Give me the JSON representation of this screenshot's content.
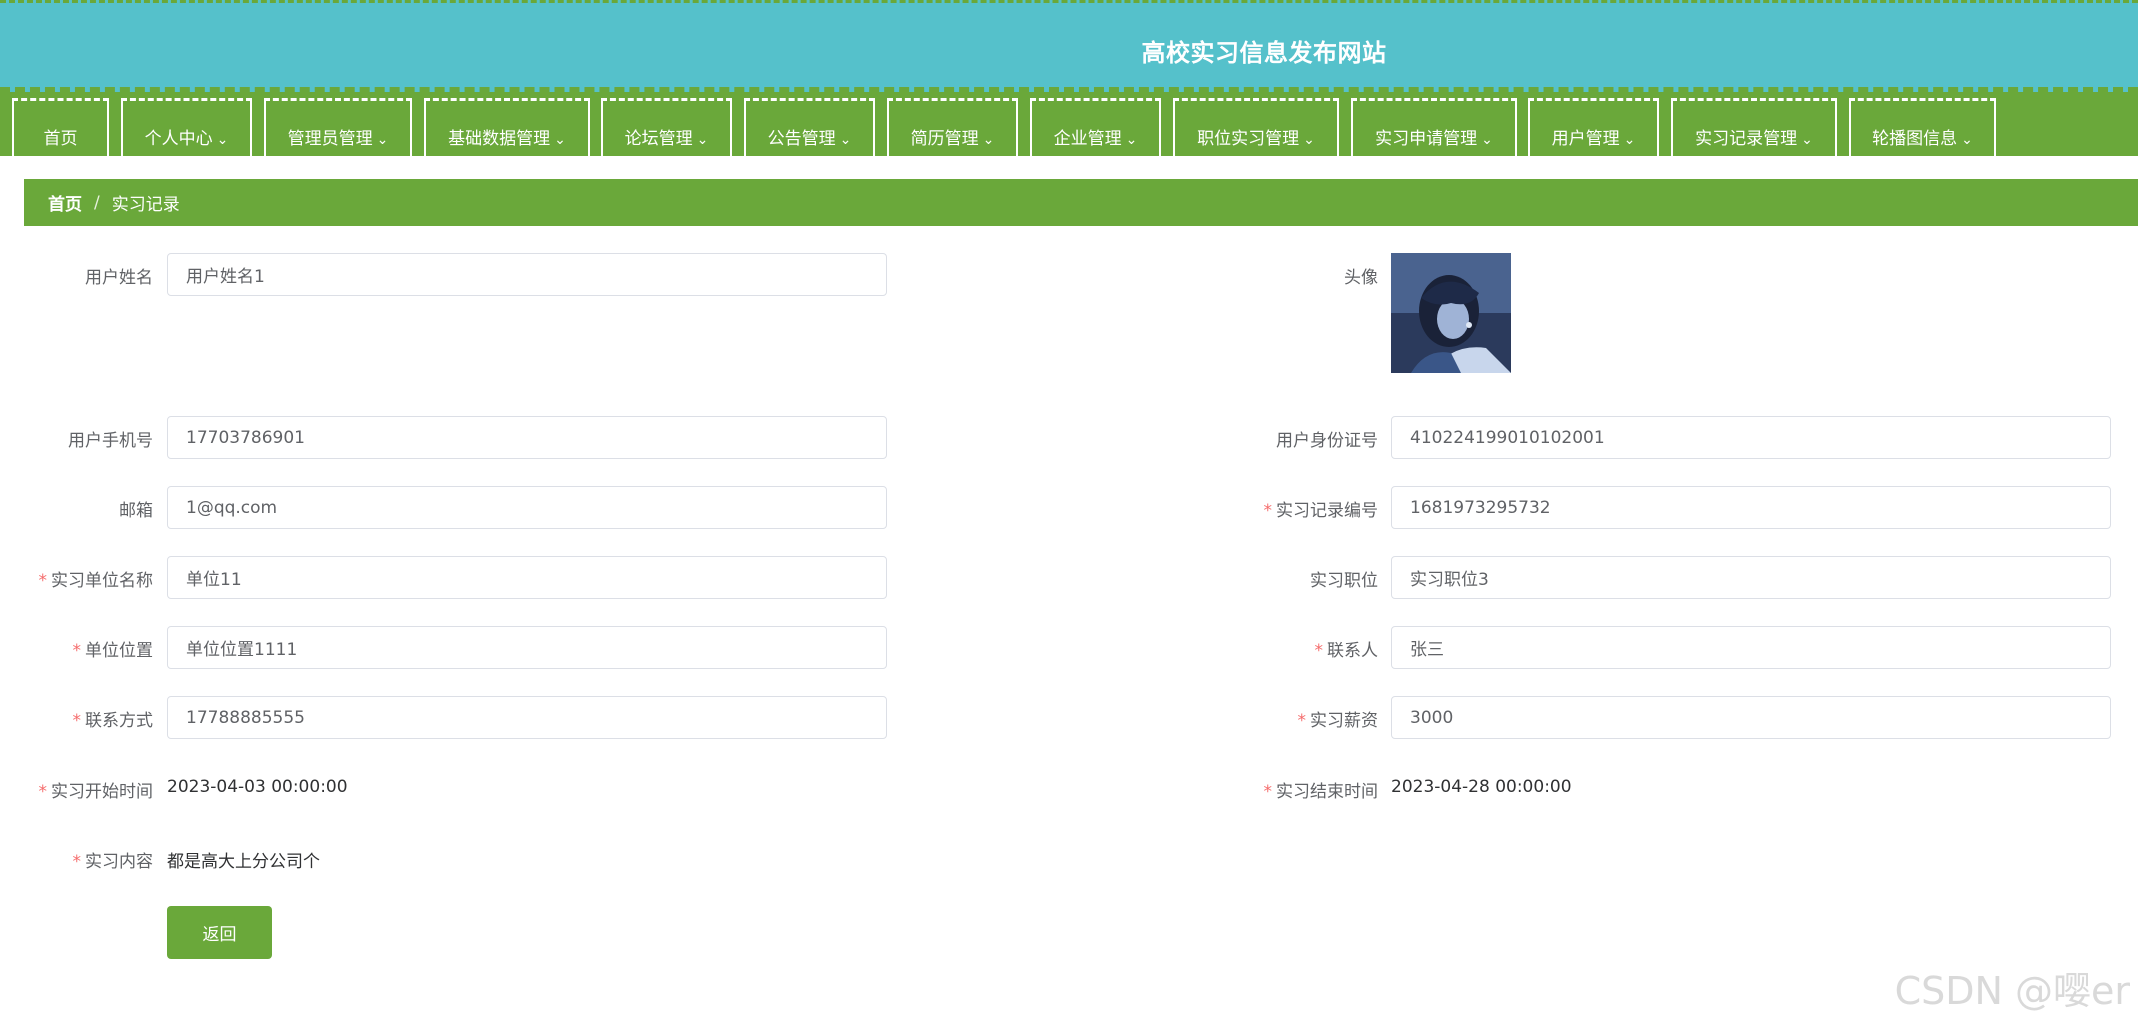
{
  "site": {
    "title": "高校实习信息发布网站"
  },
  "nav": [
    {
      "label": "首页",
      "has_dropdown": false
    },
    {
      "label": "个人中心",
      "has_dropdown": true
    },
    {
      "label": "管理员管理",
      "has_dropdown": true
    },
    {
      "label": "基础数据管理",
      "has_dropdown": true
    },
    {
      "label": "论坛管理",
      "has_dropdown": true
    },
    {
      "label": "公告管理",
      "has_dropdown": true
    },
    {
      "label": "简历管理",
      "has_dropdown": true
    },
    {
      "label": "企业管理",
      "has_dropdown": true
    },
    {
      "label": "职位实习管理",
      "has_dropdown": true
    },
    {
      "label": "实习申请管理",
      "has_dropdown": true
    },
    {
      "label": "用户管理",
      "has_dropdown": true
    },
    {
      "label": "实习记录管理",
      "has_dropdown": true
    },
    {
      "label": "轮播图信息",
      "has_dropdown": true
    }
  ],
  "breadcrumb": {
    "home": "首页",
    "separator": "/",
    "current": "实习记录"
  },
  "form": {
    "username": {
      "label": "用户姓名",
      "value": "用户姓名1"
    },
    "avatar": {
      "label": "头像"
    },
    "phone": {
      "label": "用户手机号",
      "value": "17703786901"
    },
    "id_number": {
      "label": "用户身份证号",
      "value": "410224199010102001"
    },
    "email": {
      "label": "邮箱",
      "value": "1@qq.com"
    },
    "record_no": {
      "label": "实习记录编号",
      "value": "1681973295732"
    },
    "company_name": {
      "label": "实习单位名称",
      "value": "单位11"
    },
    "position": {
      "label": "实习职位",
      "value": "实习职位3"
    },
    "company_location": {
      "label": "单位位置",
      "value": "单位位置1111"
    },
    "contact_person": {
      "label": "联系人",
      "value": "张三"
    },
    "contact_info": {
      "label": "联系方式",
      "value": "17788885555"
    },
    "salary": {
      "label": "实习薪资",
      "value": "3000"
    },
    "start_time": {
      "label": "实习开始时间",
      "value": "2023-04-03 00:00:00"
    },
    "end_time": {
      "label": "实习结束时间",
      "value": "2023-04-28 00:00:00"
    },
    "content": {
      "label": "实习内容",
      "value": "都是高大上分公司个"
    },
    "required_mark": "*"
  },
  "actions": {
    "back_label": "返回"
  },
  "watermark": "CSDN @嘤er",
  "colors": {
    "header_bg": "#55c1cb",
    "primary_green": "#6aa83a",
    "required": "#f56c6c"
  }
}
